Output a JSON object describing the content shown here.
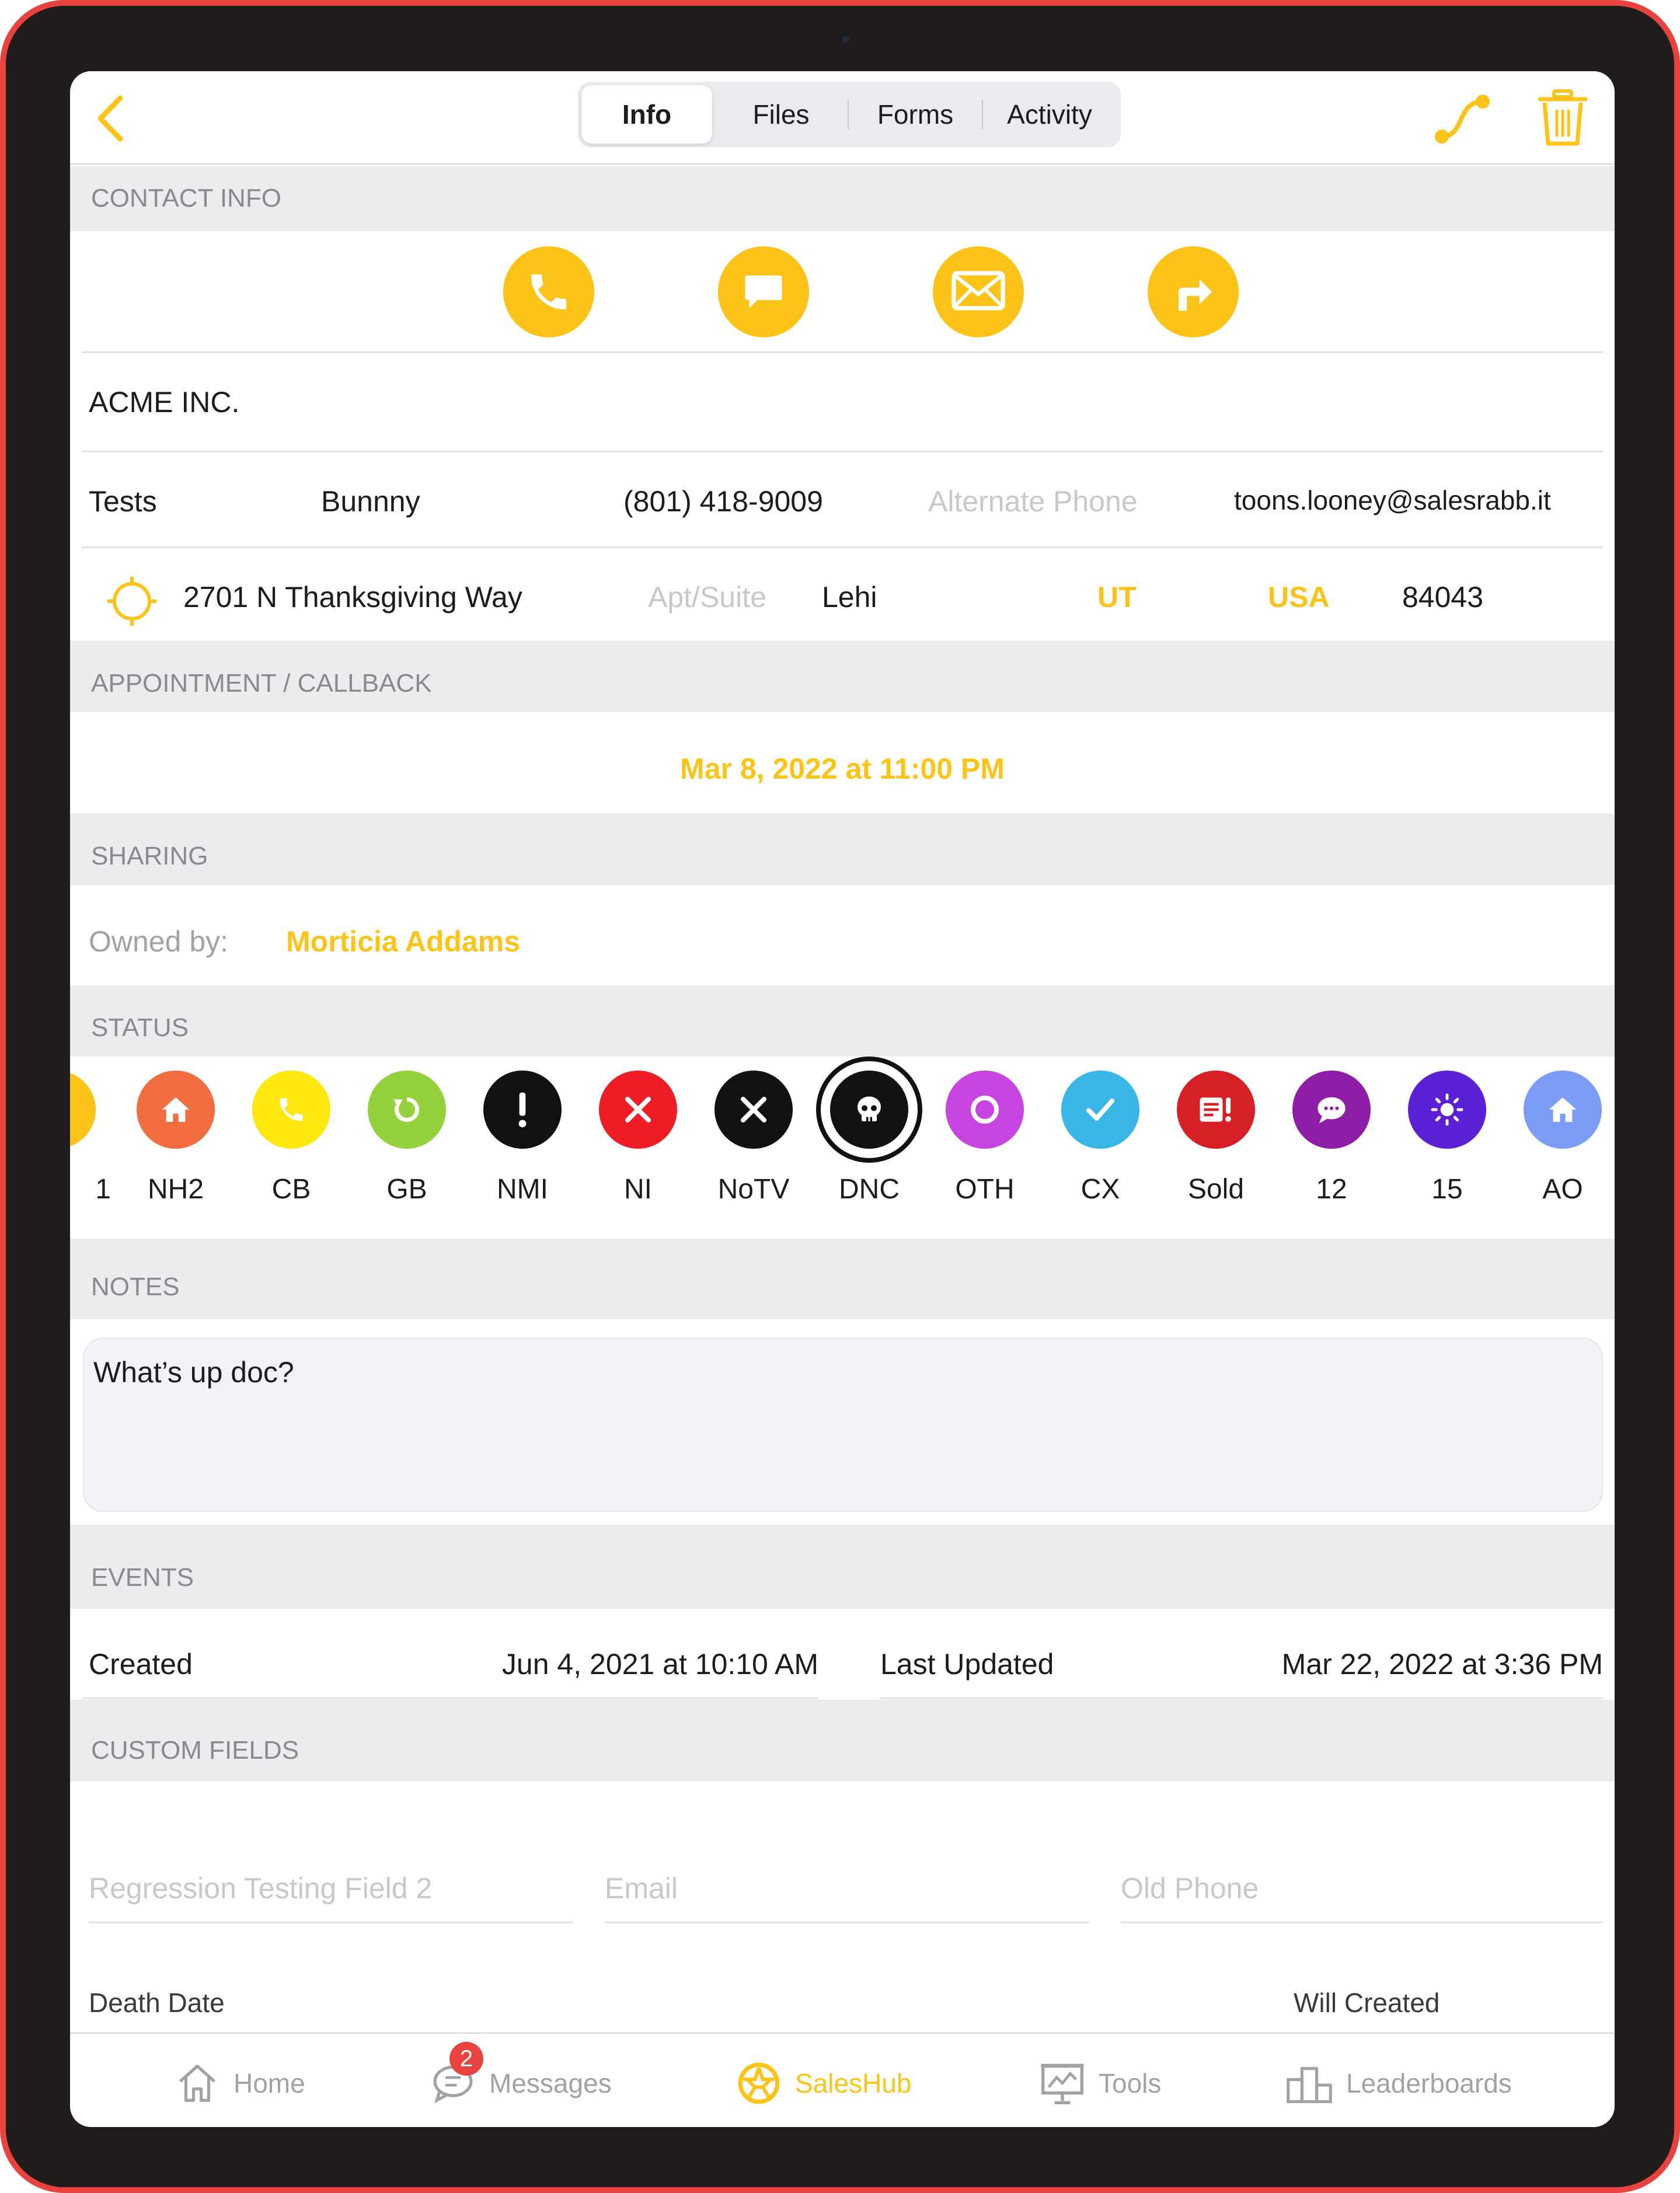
{
  "tabs": [
    "Info",
    "Files",
    "Forms",
    "Activity"
  ],
  "sections": {
    "contact": "CONTACT INFO",
    "appointment": "APPOINTMENT / CALLBACK",
    "sharing": "SHARING",
    "status": "STATUS",
    "notes": "NOTES",
    "events": "EVENTS",
    "custom": "CUSTOM FIELDS"
  },
  "contact": {
    "company": "ACME INC.",
    "first_name": "Tests",
    "last_name": "Bunnny",
    "phone": "(801) 418-9009",
    "alt_phone_placeholder": "Alternate Phone",
    "email": "toons.looney@salesrabb.it",
    "street": "2701 N Thanksgiving Way",
    "apt_placeholder": "Apt/Suite",
    "city": "Lehi",
    "state": "UT",
    "country": "USA",
    "zip": "84043"
  },
  "appointment": {
    "datetime": "Mar 8, 2022 at 11:00 PM"
  },
  "sharing": {
    "owned_label": "Owned by:",
    "owner": "Morticia Addams"
  },
  "statuses": [
    {
      "label": "1",
      "color": "#fcc419",
      "icon": "partial-icon"
    },
    {
      "label": "NH2",
      "color": "#f26d3d",
      "icon": "home-icon"
    },
    {
      "label": "CB",
      "color": "#fde910",
      "icon": "phone-icon"
    },
    {
      "label": "GB",
      "color": "#94d13b",
      "icon": "refresh-icon"
    },
    {
      "label": "NMI",
      "color": "#111111",
      "icon": "exclamation-icon"
    },
    {
      "label": "NI",
      "color": "#ee1c25",
      "icon": "x-icon"
    },
    {
      "label": "NoTV",
      "color": "#111111",
      "icon": "x-icon"
    },
    {
      "label": "DNC",
      "color": "#111111",
      "icon": "skull-icon"
    },
    {
      "label": "OTH",
      "color": "#c744e0",
      "icon": "circle-icon"
    },
    {
      "label": "CX",
      "color": "#39b6e5",
      "icon": "check-icon"
    },
    {
      "label": "Sold",
      "color": "#d71f26",
      "icon": "document-alert-icon"
    },
    {
      "label": "12",
      "color": "#8e1ca6",
      "icon": "chat-icon"
    },
    {
      "label": "15",
      "color": "#5b1fd6",
      "icon": "sun-icon"
    },
    {
      "label": "AO",
      "color": "#7c9cf5",
      "icon": "home-icon"
    }
  ],
  "notes": {
    "text": "What’s up doc?"
  },
  "events": {
    "created_label": "Created",
    "created_value": "Jun 4, 2021 at 10:10 AM",
    "updated_label": "Last Updated",
    "updated_value": "Mar 22, 2022 at 3:36 PM"
  },
  "custom_fields": {
    "field1_placeholder": "Regression Testing Field 2",
    "field2_placeholder": "Email",
    "field3_placeholder": "Old Phone",
    "death_date": "Death Date",
    "will_created": "Will Created"
  },
  "tabbar": {
    "home": "Home",
    "messages": "Messages",
    "messages_badge": "2",
    "saleshub": "SalesHub",
    "tools": "Tools",
    "leaderboards": "Leaderboards"
  },
  "colors": {
    "accent": "#fcc419",
    "frame": "#e8433f"
  }
}
